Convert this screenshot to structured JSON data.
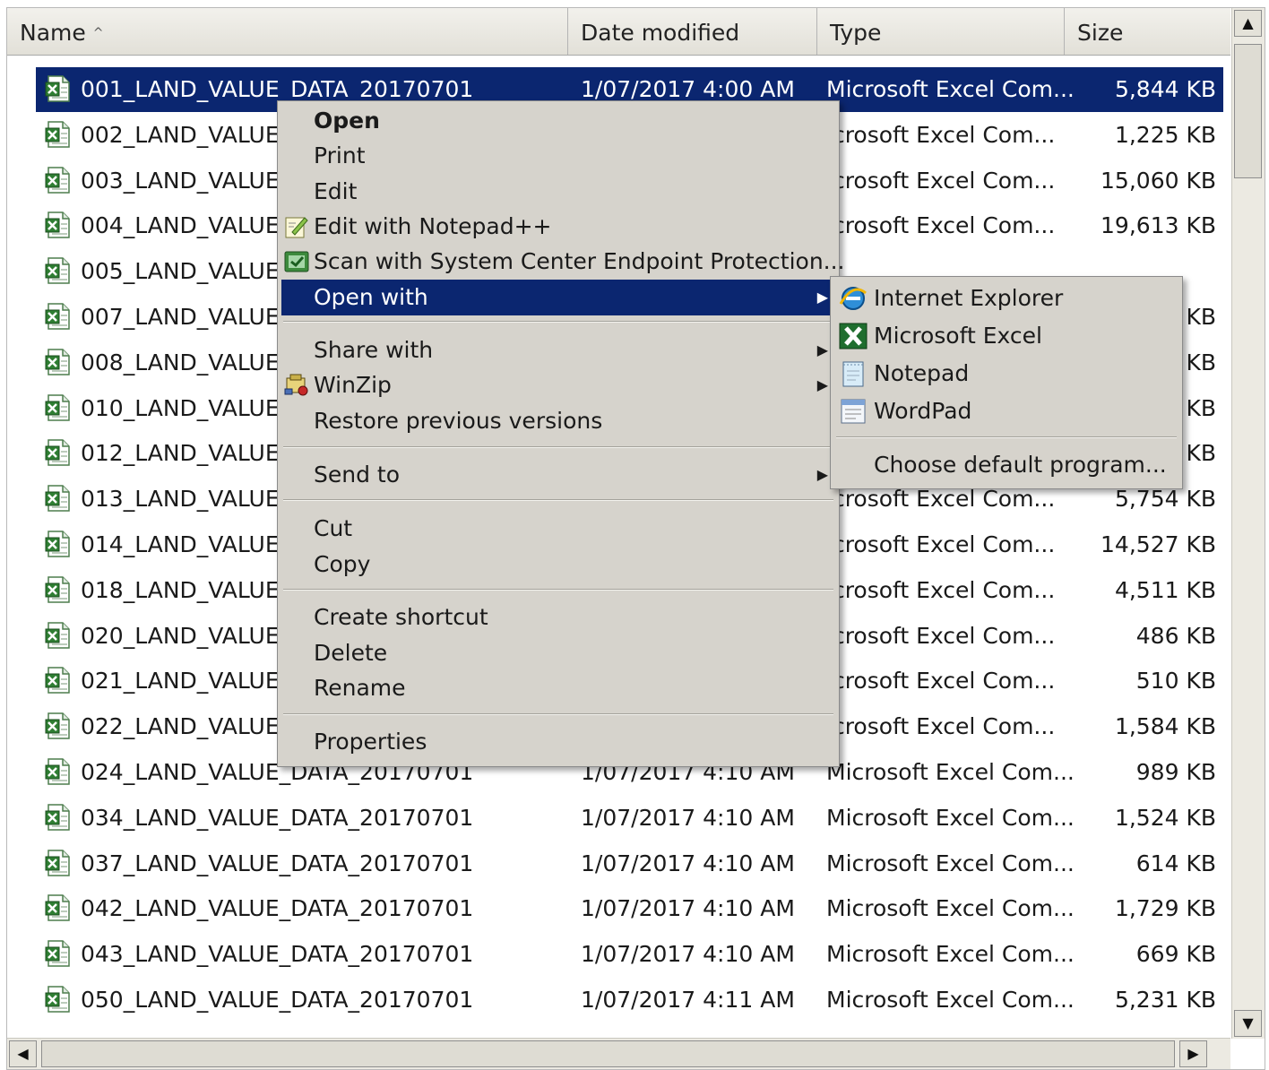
{
  "columns": {
    "name": "Name",
    "date": "Date modified",
    "type": "Type",
    "size": "Size"
  },
  "files": [
    {
      "name": "001_LAND_VALUE_DATA_20170701",
      "date": "1/07/2017 4:00 AM",
      "type": "Microsoft Excel Com...",
      "size": "5,844 KB",
      "selected": true
    },
    {
      "name": "002_LAND_VALUE_",
      "date": "",
      "type": "icrosoft Excel Com...",
      "size": "1,225 KB"
    },
    {
      "name": "003_LAND_VALUE_",
      "date": "",
      "type": "icrosoft Excel Com...",
      "size": "15,060 KB"
    },
    {
      "name": "004_LAND_VALUE_",
      "date": "",
      "type": "icrosoft Excel Com...",
      "size": "19,613 KB"
    },
    {
      "name": "005_LAND_VALUE_",
      "date": "",
      "type": "",
      "size": ""
    },
    {
      "name": "007_LAND_VALUE_",
      "date": "",
      "type": "",
      "size": "KB"
    },
    {
      "name": "008_LAND_VALUE_",
      "date": "",
      "type": "",
      "size": "KB"
    },
    {
      "name": "010_LAND_VALUE_",
      "date": "",
      "type": "",
      "size": "KB"
    },
    {
      "name": "012_LAND_VALUE_",
      "date": "",
      "type": "",
      "size": "KB"
    },
    {
      "name": "013_LAND_VALUE_",
      "date": "",
      "type": "icrosoft Excel Com...",
      "size": "5,754 KB"
    },
    {
      "name": "014_LAND_VALUE_",
      "date": "",
      "type": "icrosoft Excel Com...",
      "size": "14,527 KB"
    },
    {
      "name": "018_LAND_VALUE_",
      "date": "",
      "type": "icrosoft Excel Com...",
      "size": "4,511 KB"
    },
    {
      "name": "020_LAND_VALUE_",
      "date": "",
      "type": "icrosoft Excel Com...",
      "size": "486 KB"
    },
    {
      "name": "021_LAND_VALUE_",
      "date": "",
      "type": "icrosoft Excel Com...",
      "size": "510 KB"
    },
    {
      "name": "022_LAND_VALUE_",
      "date": "",
      "type": "icrosoft Excel Com...",
      "size": "1,584 KB"
    },
    {
      "name": "024_LAND_VALUE_DATA_20170701",
      "date": "1/07/2017 4:10 AM",
      "type": "Microsoft Excel Com...",
      "size": "989 KB"
    },
    {
      "name": "034_LAND_VALUE_DATA_20170701",
      "date": "1/07/2017 4:10 AM",
      "type": "Microsoft Excel Com...",
      "size": "1,524 KB"
    },
    {
      "name": "037_LAND_VALUE_DATA_20170701",
      "date": "1/07/2017 4:10 AM",
      "type": "Microsoft Excel Com...",
      "size": "614 KB"
    },
    {
      "name": "042_LAND_VALUE_DATA_20170701",
      "date": "1/07/2017 4:10 AM",
      "type": "Microsoft Excel Com...",
      "size": "1,729 KB"
    },
    {
      "name": "043_LAND_VALUE_DATA_20170701",
      "date": "1/07/2017 4:10 AM",
      "type": "Microsoft Excel Com...",
      "size": "669 KB"
    },
    {
      "name": "050_LAND_VALUE_DATA_20170701",
      "date": "1/07/2017 4:11 AM",
      "type": "Microsoft Excel Com...",
      "size": "5,231 KB"
    }
  ],
  "context_menu": {
    "open": "Open",
    "print": "Print",
    "edit": "Edit",
    "edit_notepadpp": "Edit with Notepad++",
    "scan": "Scan with System Center Endpoint Protection...",
    "open_with": "Open with",
    "share_with": "Share with",
    "winzip": "WinZip",
    "restore": "Restore previous versions",
    "send_to": "Send to",
    "cut": "Cut",
    "copy": "Copy",
    "create_shortcut": "Create shortcut",
    "delete": "Delete",
    "rename": "Rename",
    "properties": "Properties"
  },
  "open_with_menu": {
    "internet_explorer": "Internet Explorer",
    "excel": "Microsoft Excel",
    "notepad": "Notepad",
    "wordpad": "WordPad",
    "choose_default": "Choose default program..."
  },
  "colors": {
    "selection": "#0b2670",
    "menu_bg": "#d6d3cc",
    "excel_green": "#2e7d32"
  }
}
